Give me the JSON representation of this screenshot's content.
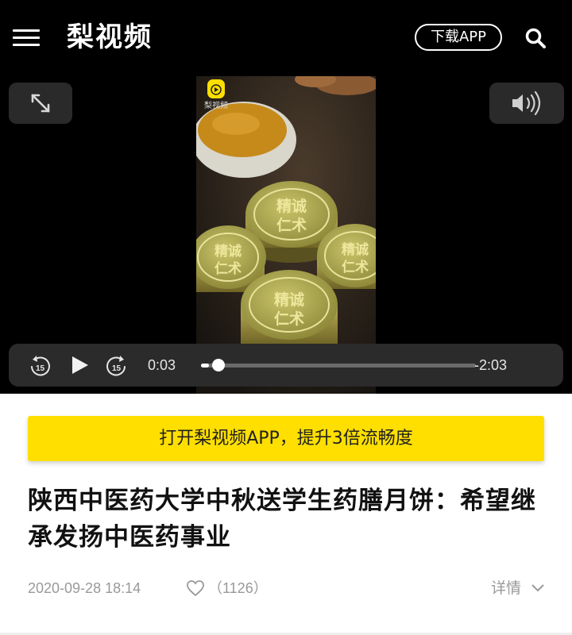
{
  "header": {
    "logo_text": "梨视频",
    "download_label": "下载APP",
    "icons": {
      "menu": "hamburger-menu-icon",
      "search": "search-icon"
    }
  },
  "player": {
    "watermark_icon": "pear-video-watermark-icon",
    "watermark_text": "梨视频",
    "mooncake_text_a": "精诚",
    "mooncake_text_b": "仁术",
    "current_time": "0:03",
    "remaining_time": "-2:03",
    "progress_fraction": 0.03,
    "rewind_label": "15",
    "forward_label": "15",
    "icons": {
      "expand": "expand-icon",
      "volume": "volume-icon",
      "rewind": "rewind-15-icon",
      "play": "play-icon",
      "forward": "forward-15-icon"
    }
  },
  "banner": {
    "label": "打开梨视频APP，提升3倍流畅度"
  },
  "article": {
    "title": "陕西中医药大学中秋送学生药膳月饼：希望继承发扬中医药事业",
    "date": "2020-09-28 18:14",
    "like_count": "（1126）",
    "details_label": "详情"
  },
  "colors": {
    "header_bg": "#000000",
    "banner_bg": "#ffdf00",
    "meta_text": "#999999",
    "title_text": "#111111"
  }
}
